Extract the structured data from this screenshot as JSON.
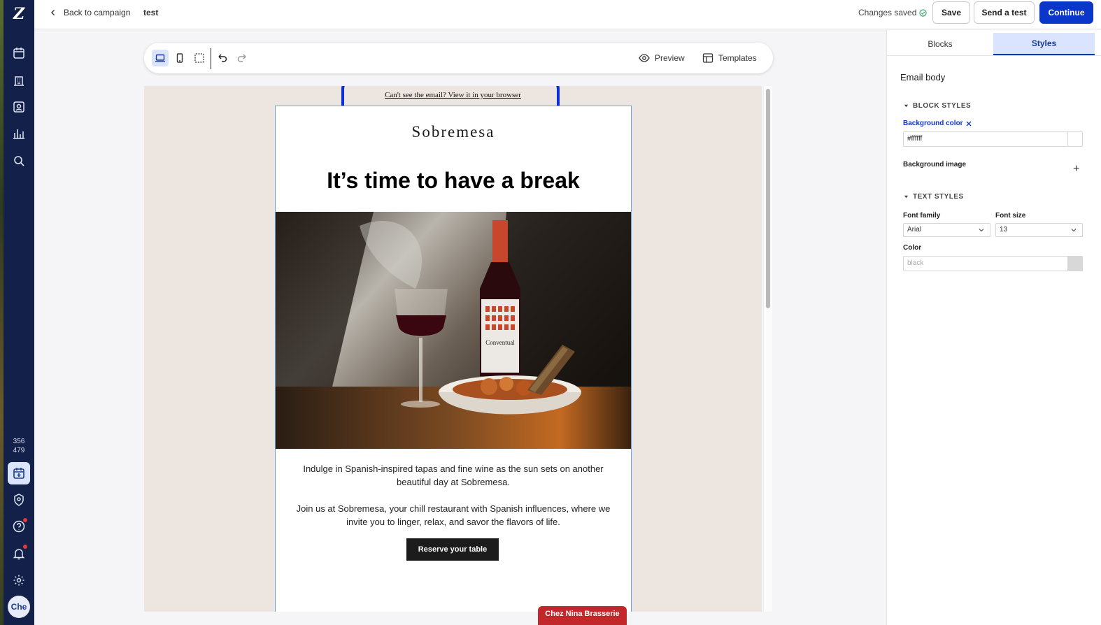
{
  "app": {
    "logo_glyph": "Z"
  },
  "header": {
    "back_label": "Back to campaign",
    "document_name": "test",
    "status": "Changes saved",
    "save_label": "Save",
    "send_test_label": "Send a test",
    "continue_label": "Continue"
  },
  "sidebar": {
    "items": [
      {
        "icon": "calendar-icon"
      },
      {
        "icon": "building-icon"
      },
      {
        "icon": "contacts-icon"
      },
      {
        "icon": "chart-icon"
      },
      {
        "icon": "search-icon"
      }
    ],
    "count_top": "356",
    "count_bottom": "479",
    "bottom_items": [
      {
        "icon": "calendar-plus-icon",
        "active": true
      },
      {
        "icon": "shield-icon"
      },
      {
        "icon": "help-icon",
        "badge": true
      },
      {
        "icon": "bell-icon",
        "badge": true
      },
      {
        "icon": "gear-icon"
      }
    ],
    "avatar_initials": "Che"
  },
  "toolbar": {
    "view_buttons": [
      "desktop-icon",
      "mobile-icon",
      "select-frame-icon"
    ],
    "undo_icon": "undo-icon",
    "redo_icon": "redo-icon",
    "preview_label": "Preview",
    "templates_label": "Templates"
  },
  "email": {
    "browser_link": "Can't see the email? View it in your browser",
    "brand_name": "Sobremesa",
    "headline": "It’s time to have a break",
    "hero_label": "Conventual",
    "paragraph_1": "Indulge in Spanish-inspired tapas and fine wine as the sun sets on another beautiful day at Sobremesa.",
    "paragraph_2": "Join us at Sobremesa, your chill restaurant with Spanish influences, where we invite you to linger, relax, and savor the flavors of life.",
    "cta_label": "Reserve your table",
    "canvas_bg": "#ede5df"
  },
  "account_chip": "Chez Nina Brasserie",
  "panel": {
    "tabs": [
      {
        "label": "Blocks",
        "active": false
      },
      {
        "label": "Styles",
        "active": true
      }
    ],
    "title": "Email body",
    "block_styles_heading": "BLOCK STYLES",
    "background_color_label": "Background color",
    "background_color_value": "#ffffff",
    "background_image_label": "Background image",
    "text_styles_heading": "TEXT STYLES",
    "font_family_label": "Font family",
    "font_family_value": "Arial",
    "font_size_label": "Font size",
    "font_size_value": "13",
    "color_label": "Color",
    "color_placeholder": "black"
  },
  "colors": {
    "primary": "#0a36c9",
    "sidebar_bg": "#13204a",
    "highlight_ring": "#0a2fd6",
    "chip": "#c2282a"
  }
}
